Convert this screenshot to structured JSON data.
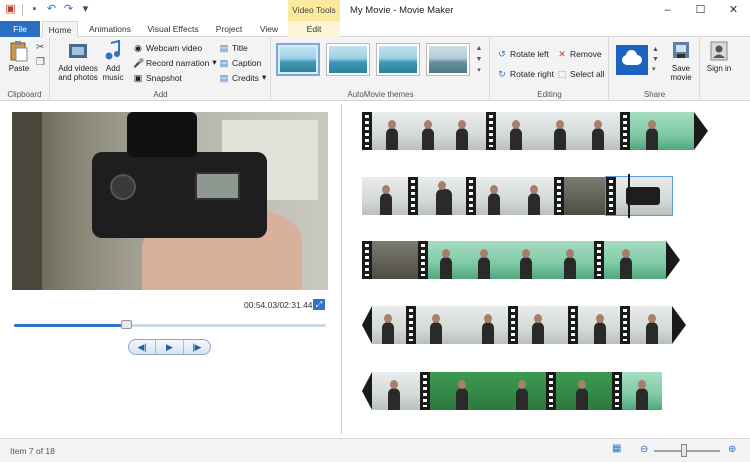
{
  "titlebar": {
    "title": "My Movie - Movie Maker",
    "contextual_group": "Video Tools",
    "qat_icons": [
      "app-icon",
      "save-icon",
      "undo-icon",
      "redo-icon",
      "customize-qat-icon"
    ],
    "controls": {
      "minimize": "–",
      "maximize": "☐",
      "close": "✕"
    }
  },
  "tabs": {
    "file": "File",
    "home": "Home",
    "animations": "Animations",
    "visual_effects": "Visual Effects",
    "project": "Project",
    "view": "View",
    "edit": "Edit"
  },
  "ribbon": {
    "clipboard": {
      "label": "Clipboard",
      "paste": "Paste"
    },
    "add": {
      "label": "Add",
      "add_videos": "Add videos and photos",
      "add_music": "Add music",
      "webcam_video": "Webcam video",
      "record_narration": "Record narration",
      "snapshot": "Snapshot",
      "title": "Title",
      "caption": "Caption",
      "credits": "Credits"
    },
    "automovie": {
      "label": "AutoMovie themes"
    },
    "editing": {
      "label": "Editing",
      "rotate_left": "Rotate left",
      "rotate_right": "Rotate right",
      "remove": "Remove",
      "select_all": "Select all"
    },
    "share": {
      "label": "Share",
      "save_movie": "Save movie",
      "sign_in": "Sign in"
    }
  },
  "preview": {
    "timecode": "00:54.03/02:31.44",
    "seek_progress": 0.36,
    "transport": {
      "prev": "◀|",
      "play": "▶",
      "next": "|▶"
    }
  },
  "storyboard": {
    "rows": 5,
    "selected_item": 7
  },
  "status": {
    "item_text": "Item 7 of 18",
    "zoom_out": "⊖",
    "zoom_in": "⊕",
    "zoom_level": 0.45
  },
  "colors": {
    "accent": "#2b6fc4",
    "contextual_tab": "#fbe99e",
    "onedrive": "#1a63c1"
  }
}
